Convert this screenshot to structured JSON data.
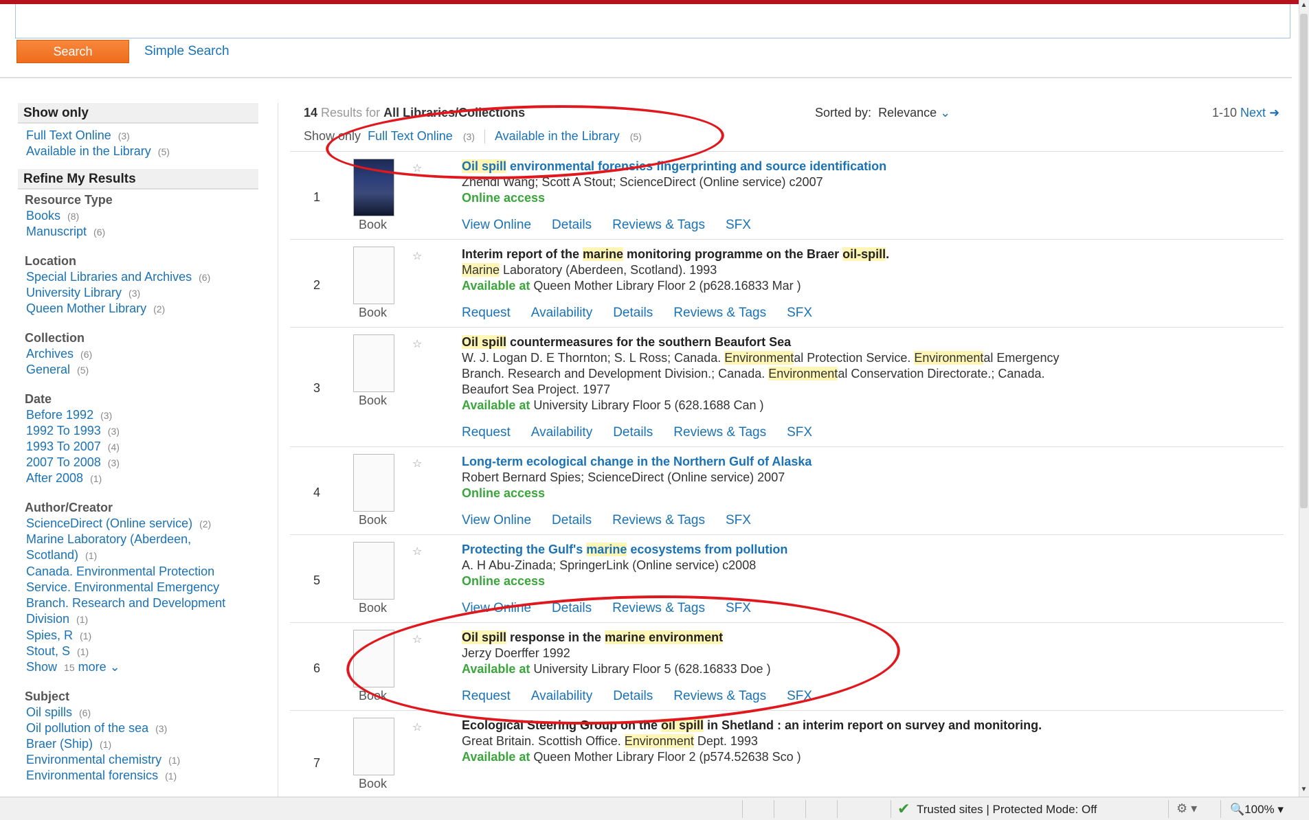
{
  "search": {
    "button_label": "Search",
    "simple_search": "Simple Search"
  },
  "sidebar": {
    "show_only_heading": "Show only",
    "show_only": [
      {
        "label": "Full Text Online",
        "count": "(3)"
      },
      {
        "label": "Available in the Library",
        "count": "(5)"
      }
    ],
    "refine_heading": "Refine My Results",
    "facets": [
      {
        "name": "Resource Type",
        "items": [
          {
            "label": "Books",
            "count": "(8)"
          },
          {
            "label": "Manuscript",
            "count": "(6)"
          }
        ]
      },
      {
        "name": "Location",
        "items": [
          {
            "label": "Special Libraries and Archives",
            "count": "(6)"
          },
          {
            "label": "University Library",
            "count": "(3)"
          },
          {
            "label": "Queen Mother Library",
            "count": "(2)"
          }
        ]
      },
      {
        "name": "Collection",
        "items": [
          {
            "label": "Archives",
            "count": "(6)"
          },
          {
            "label": "General",
            "count": "(5)"
          }
        ]
      },
      {
        "name": "Date",
        "items": [
          {
            "label": "Before 1992",
            "count": "(3)"
          },
          {
            "label": "1992 To 1993",
            "count": "(3)"
          },
          {
            "label": "1993 To 2007",
            "count": "(4)"
          },
          {
            "label": "2007 To 2008",
            "count": "(3)"
          },
          {
            "label": "After 2008",
            "count": "(1)"
          }
        ]
      },
      {
        "name": "Author/Creator",
        "items": [
          {
            "label": "ScienceDirect (Online service)",
            "count": "(2)"
          },
          {
            "label": "Marine Laboratory (Aberdeen, Scotland)",
            "count": "(1)"
          },
          {
            "label": "Canada. Environmental Protection Service. Environmental Emergency Branch. Research and Development Division",
            "count": "(1)"
          },
          {
            "label": "Spies, R",
            "count": "(1)"
          },
          {
            "label": "Stout, S",
            "count": "(1)"
          }
        ],
        "show_more": {
          "show": "Show",
          "count": "15",
          "more": "more"
        }
      },
      {
        "name": "Subject",
        "items": [
          {
            "label": "Oil spills",
            "count": "(6)"
          },
          {
            "label": "Oil pollution of the sea",
            "count": "(3)"
          },
          {
            "label": "Braer (Ship)",
            "count": "(1)"
          },
          {
            "label": "Environmental chemistry",
            "count": "(1)"
          },
          {
            "label": "Environmental forensics",
            "count": "(1)"
          }
        ]
      }
    ]
  },
  "results": {
    "count": "14",
    "results_for": "Results for",
    "scope": "All Libraries/Collections",
    "sorted_by_label": "Sorted by:",
    "sorted_by_value": "Relevance",
    "range": "1-10",
    "next": "Next",
    "show_only_label": "Show only",
    "filters": [
      {
        "label": "Full Text Online",
        "count": "(3)"
      },
      {
        "label": "Available in the Library",
        "count": "(5)"
      }
    ],
    "thumb_label": "Book",
    "records": [
      {
        "num": "1",
        "title": "Oil spill environmental forensics fingerprinting and source identification",
        "authors": "Zhendi Wang; Scott A Stout; ScienceDirect (Online service) c2007",
        "status": "Online access",
        "location": "",
        "actions": [
          "View Online",
          "Details",
          "Reviews & Tags",
          "SFX"
        ]
      },
      {
        "num": "2",
        "title": "Interim report of the marine monitoring programme on the Braer oil-spill.",
        "authors": "Marine Laboratory (Aberdeen, Scotland). 1993",
        "status": "Available at",
        "location": "Queen Mother Library Floor 2 (p628.16833 Mar )",
        "actions": [
          "Request",
          "Availability",
          "Details",
          "Reviews & Tags",
          "SFX"
        ]
      },
      {
        "num": "3",
        "title": "Oil spill countermeasures for the southern Beaufort Sea",
        "authors": "W. J. Logan D. E Thornton; S. L Ross; Canada. Environmental Protection Service. Environmental Emergency Branch. Research and Development Division.; Canada. Environmental Conservation Directorate.; Canada. Beaufort Sea Project. 1977",
        "status": "Available at",
        "location": "University Library Floor 5 (628.1688 Can )",
        "actions": [
          "Request",
          "Availability",
          "Details",
          "Reviews & Tags",
          "SFX"
        ]
      },
      {
        "num": "4",
        "title": "Long-term ecological change in the Northern Gulf of Alaska",
        "authors": "Robert Bernard Spies; ScienceDirect (Online service) 2007",
        "status": "Online access",
        "location": "",
        "actions": [
          "View Online",
          "Details",
          "Reviews & Tags",
          "SFX"
        ]
      },
      {
        "num": "5",
        "title": "Protecting the Gulf's marine ecosystems from pollution",
        "authors": "A. H Abu-Zinada; SpringerLink (Online service) c2008",
        "status": "Online access",
        "location": "",
        "actions": [
          "View Online",
          "Details",
          "Reviews & Tags",
          "SFX"
        ]
      },
      {
        "num": "6",
        "title": "Oil spill response in the marine environment",
        "authors": "Jerzy Doerffer 1992",
        "status": "Available at",
        "location": "University Library Floor 5 (628.16833 Doe )",
        "actions": [
          "Request",
          "Availability",
          "Details",
          "Reviews & Tags",
          "SFX"
        ]
      },
      {
        "num": "7",
        "title": "Ecological Steering Group on the oil spill in Shetland : an interim report on survey and monitoring.",
        "authors": "Great Britain. Scottish Office. Environment Dept. 1993",
        "status": "Available at",
        "location": "Queen Mother Library Floor 2 (p574.52638 Sco )",
        "actions": []
      }
    ]
  },
  "statusbar": {
    "security": "Trusted sites | Protected Mode: Off",
    "zoom": "100%"
  },
  "colors": {
    "brand_red": "#b5121b",
    "link_blue": "#1a72b6",
    "available_green": "#3aa53a",
    "search_orange": "#ef6c1b",
    "annotation_red": "#e0171d",
    "highlight_yellow": "#fff6b5"
  }
}
